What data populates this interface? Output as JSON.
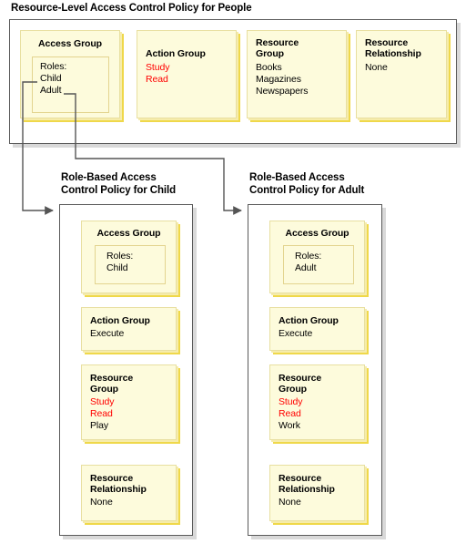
{
  "diagram": {
    "title": "Resource-Level Access Control Policy for People",
    "accent_red": "#ff0000",
    "card_fill": "#fdfbdc",
    "card_shadow": "#efd84a",
    "container_border": "#5a5a5a"
  },
  "people_policy": {
    "title": "Resource-Level Access Control Policy for People",
    "cards": [
      {
        "title": "Access Group",
        "roles_label": "Roles:",
        "roles": [
          "Child",
          "Adult"
        ]
      },
      {
        "title": "Action Group",
        "items": [
          {
            "text": "Study",
            "color": "red"
          },
          {
            "text": "Read",
            "color": "red"
          }
        ]
      },
      {
        "title_line1": "Resource",
        "title_line2": "Group",
        "items": [
          {
            "text": "Books",
            "color": "black"
          },
          {
            "text": "Magazines",
            "color": "black"
          },
          {
            "text": "Newspapers",
            "color": "black"
          }
        ]
      },
      {
        "title_line1": "Resource",
        "title_line2": "Relationship",
        "items": [
          {
            "text": "None",
            "color": "black"
          }
        ]
      }
    ]
  },
  "child_policy": {
    "title_line1": "Role-Based Access",
    "title_line2": "Control Policy for Child",
    "access_group": {
      "title": "Access Group",
      "roles_label": "Roles:",
      "roles": [
        "Child"
      ]
    },
    "action_group": {
      "title": "Action Group",
      "items": [
        {
          "text": "Execute",
          "color": "black"
        }
      ]
    },
    "resource_group": {
      "title_line1": "Resource",
      "title_line2": "Group",
      "items": [
        {
          "text": "Study",
          "color": "red"
        },
        {
          "text": "Read",
          "color": "red"
        },
        {
          "text": "Play",
          "color": "black"
        }
      ]
    },
    "resource_relationship": {
      "title_line1": "Resource",
      "title_line2": "Relationship",
      "items": [
        {
          "text": "None",
          "color": "black"
        }
      ]
    }
  },
  "adult_policy": {
    "title_line1": "Role-Based Access",
    "title_line2": "Control Policy for Adult",
    "access_group": {
      "title": "Access Group",
      "roles_label": "Roles:",
      "roles": [
        "Adult"
      ]
    },
    "action_group": {
      "title": "Action Group",
      "items": [
        {
          "text": "Execute",
          "color": "black"
        }
      ]
    },
    "resource_group": {
      "title_line1": "Resource",
      "title_line2": "Group",
      "items": [
        {
          "text": "Study",
          "color": "red"
        },
        {
          "text": "Read",
          "color": "red"
        },
        {
          "text": "Work",
          "color": "black"
        }
      ]
    },
    "resource_relationship": {
      "title_line1": "Resource",
      "title_line2": "Relationship",
      "items": [
        {
          "text": "None",
          "color": "black"
        }
      ]
    }
  },
  "connectors": [
    {
      "from": "Child",
      "to": "Role-Based Access Control Policy for Child"
    },
    {
      "from": "Adult",
      "to": "Role-Based Access Control Policy for Adult"
    }
  ]
}
